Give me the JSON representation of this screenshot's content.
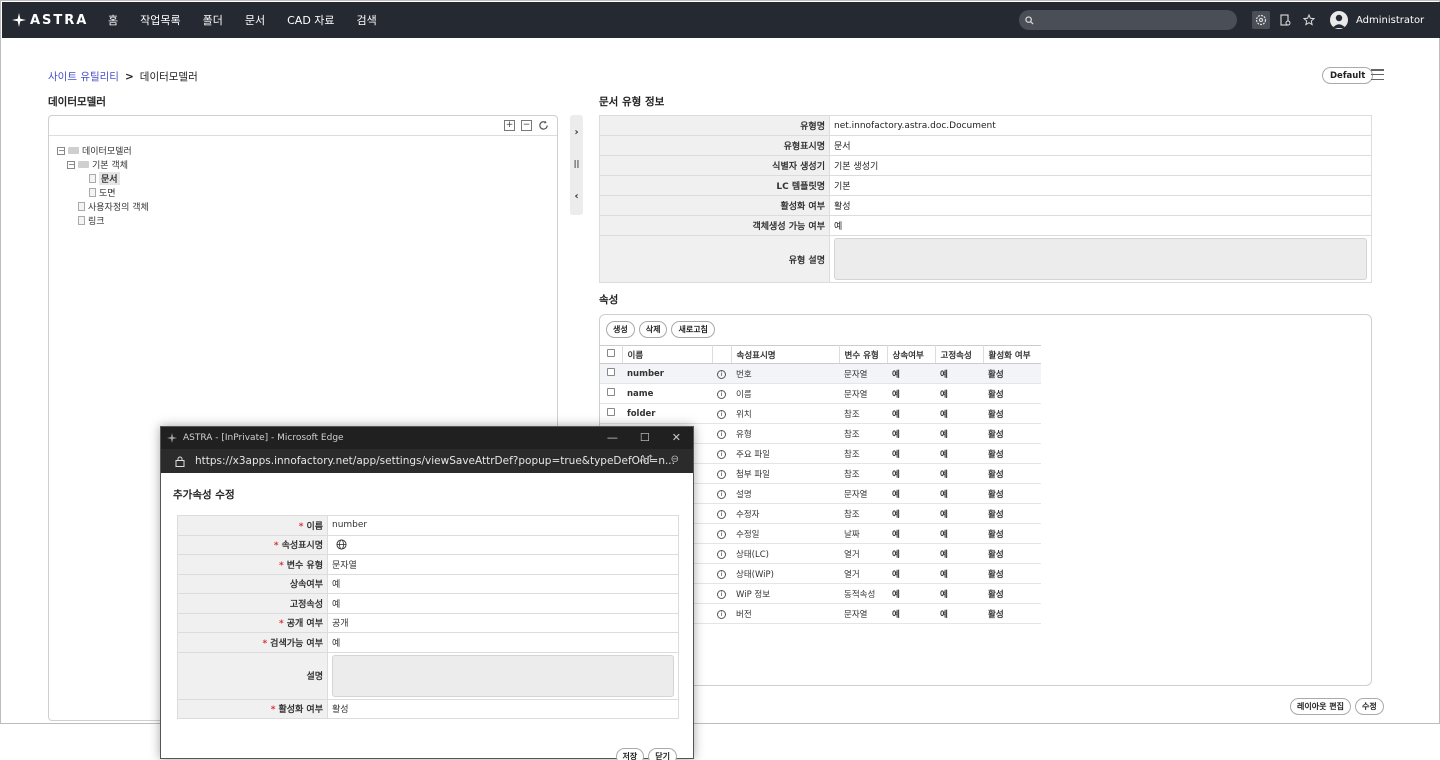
{
  "nav": {
    "logo": "ASTRA",
    "menu": [
      "홈",
      "작업목록",
      "폴더",
      "문서",
      "CAD 자료",
      "검색"
    ],
    "user": "Administrator"
  },
  "breadcrumb": {
    "parent": "사이트 유틸리티",
    "sep": ">",
    "current": "데이터모델러"
  },
  "default_label": "Default",
  "left_title": "데이터모델러",
  "tree": {
    "root": "데이터모델러",
    "base": "기본 객체",
    "doc": "문서",
    "drawing": "도면",
    "custom": "사용자정의 객체",
    "link": "링크"
  },
  "info": {
    "title": "문서 유형 정보",
    "rows": [
      {
        "label": "유형명",
        "value": "net.innofactory.astra.doc.Document"
      },
      {
        "label": "유형표시명",
        "value": "문서"
      },
      {
        "label": "식별자 생성기",
        "value": "기본 생성기"
      },
      {
        "label": "LC 템플릿명",
        "value": "기본"
      },
      {
        "label": "활성화 여부",
        "value": "활성"
      },
      {
        "label": "객체생성 가능 여부",
        "value": "예"
      },
      {
        "label": "유형 설명",
        "value": ""
      }
    ]
  },
  "attrs": {
    "title": "속성",
    "buttons": {
      "create": "생성",
      "delete": "삭제",
      "refresh": "새로고침"
    },
    "headers": [
      "이름",
      "속성표시명",
      "변수 유형",
      "상속여부",
      "고정속성",
      "활성화 여부"
    ],
    "rows": [
      {
        "name": "number",
        "display": "번호",
        "type": "문자열",
        "inherit": "예",
        "fixed": "예",
        "active": "활성"
      },
      {
        "name": "name",
        "display": "이름",
        "type": "문자열",
        "inherit": "예",
        "fixed": "예",
        "active": "활성"
      },
      {
        "name": "folder",
        "display": "위치",
        "type": "참조",
        "inherit": "예",
        "fixed": "예",
        "active": "활성"
      },
      {
        "name": "",
        "display": "유형",
        "type": "참조",
        "inherit": "예",
        "fixed": "예",
        "active": "활성"
      },
      {
        "name": "",
        "display": "주요 파일",
        "type": "참조",
        "inherit": "예",
        "fixed": "예",
        "active": "활성"
      },
      {
        "name": "",
        "display": "첨부 파일",
        "type": "참조",
        "inherit": "예",
        "fixed": "예",
        "active": "활성"
      },
      {
        "name": "",
        "display": "설명",
        "type": "문자열",
        "inherit": "예",
        "fixed": "예",
        "active": "활성"
      },
      {
        "name": "",
        "display": "수정자",
        "type": "참조",
        "inherit": "예",
        "fixed": "예",
        "active": "활성"
      },
      {
        "name": "",
        "display": "수정일",
        "type": "날짜",
        "inherit": "예",
        "fixed": "예",
        "active": "활성"
      },
      {
        "name": "",
        "display": "상태(LC)",
        "type": "열거",
        "inherit": "예",
        "fixed": "예",
        "active": "활성"
      },
      {
        "name": "",
        "display": "상태(WiP)",
        "type": "열거",
        "inherit": "예",
        "fixed": "예",
        "active": "활성"
      },
      {
        "name": "",
        "display": "WiP 정보",
        "type": "동적속성",
        "inherit": "예",
        "fixed": "예",
        "active": "활성"
      },
      {
        "name": "",
        "display": "버전",
        "type": "문자열",
        "inherit": "예",
        "fixed": "예",
        "active": "활성"
      }
    ]
  },
  "bottom": {
    "layout_edit": "레이아웃 편집",
    "edit": "수정"
  },
  "popup": {
    "window_title": "ASTRA - [InPrivate] - Microsoft Edge",
    "url": "https://x3apps.innofactory.net/app/settings/viewSaveAttrDef?popup=true&typeDefOid=n...",
    "heading": "추가속성 수정",
    "rows": [
      {
        "label": "이름",
        "value": "number",
        "req": "*"
      },
      {
        "label": "속성표시명",
        "value": "",
        "req": "*"
      },
      {
        "label": "변수 유형",
        "value": "문자열",
        "req": "*"
      },
      {
        "label": "상속여부",
        "value": "예",
        "req": ""
      },
      {
        "label": "고정속성",
        "value": "예",
        "req": ""
      },
      {
        "label": "공개 여부",
        "value": "공개",
        "req": "*"
      },
      {
        "label": "검색가능 여부",
        "value": "예",
        "req": "*"
      },
      {
        "label": "설명",
        "value": "",
        "req": ""
      },
      {
        "label": "활성화 여부",
        "value": "활성",
        "req": "*"
      }
    ],
    "save": "저장",
    "close": "닫기"
  }
}
